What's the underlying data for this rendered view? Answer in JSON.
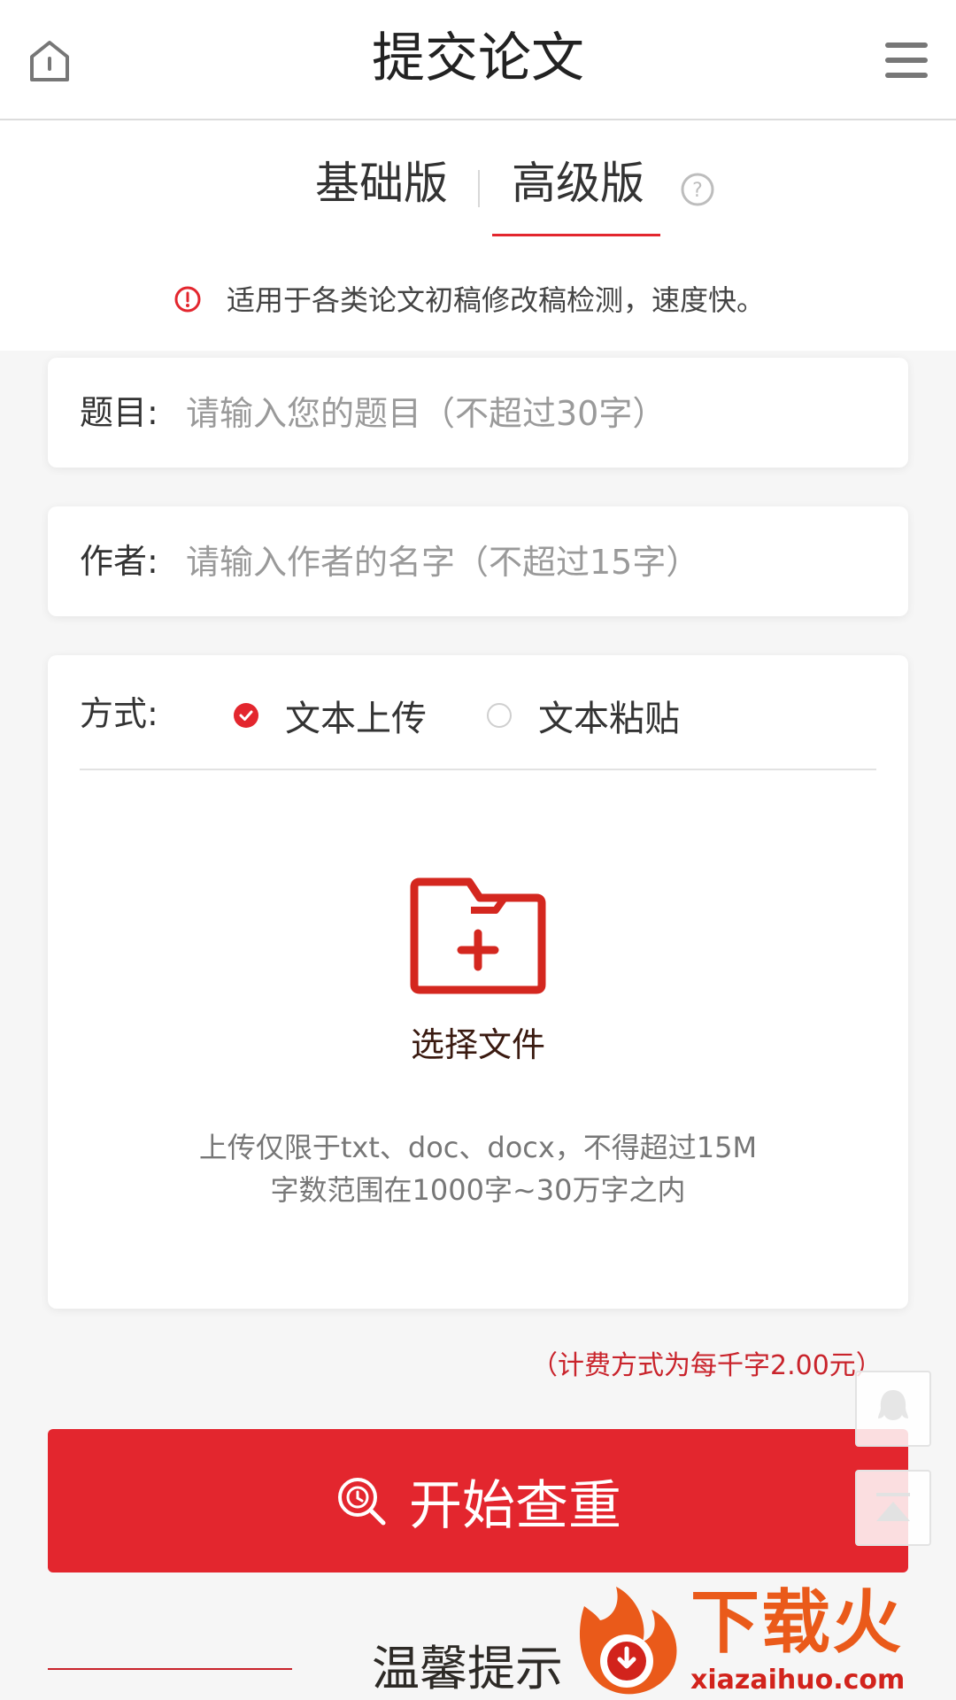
{
  "header": {
    "title": "提交论文"
  },
  "tabs": [
    {
      "label": "基础版",
      "active": false
    },
    {
      "label": "高级版",
      "active": true
    }
  ],
  "notice": {
    "text": "适用于各类论文初稿修改稿检测，速度快。"
  },
  "form": {
    "title_label": "题目:",
    "title_placeholder": "请输入您的题目（不超过30字）",
    "author_label": "作者:",
    "author_placeholder": "请输入作者的名字（不超过15字）",
    "method_label": "方式:",
    "methods": [
      {
        "label": "文本上传",
        "checked": true
      },
      {
        "label": "文本粘贴",
        "checked": false
      }
    ]
  },
  "upload": {
    "choose_label": "选择文件",
    "hint_line1": "上传仅限于txt、doc、docx，不得超过15M",
    "hint_line2": "字数范围在1000字~30万字之内"
  },
  "fee_note": "（计费方式为每千字2.00元）",
  "start_button": "开始查重",
  "tips_title": "温馨提示",
  "watermark": {
    "brand": "下载火",
    "domain": "xiazaihuo.com"
  },
  "colors": {
    "accent": "#e3262e",
    "fee_text": "#c9232b",
    "watermark_orange": "#ea5a1a"
  },
  "icons": [
    "home-icon",
    "menu-icon",
    "help-icon",
    "alert-icon",
    "folder-add-icon",
    "search-check-icon",
    "chat-icon",
    "back-to-top-icon"
  ]
}
